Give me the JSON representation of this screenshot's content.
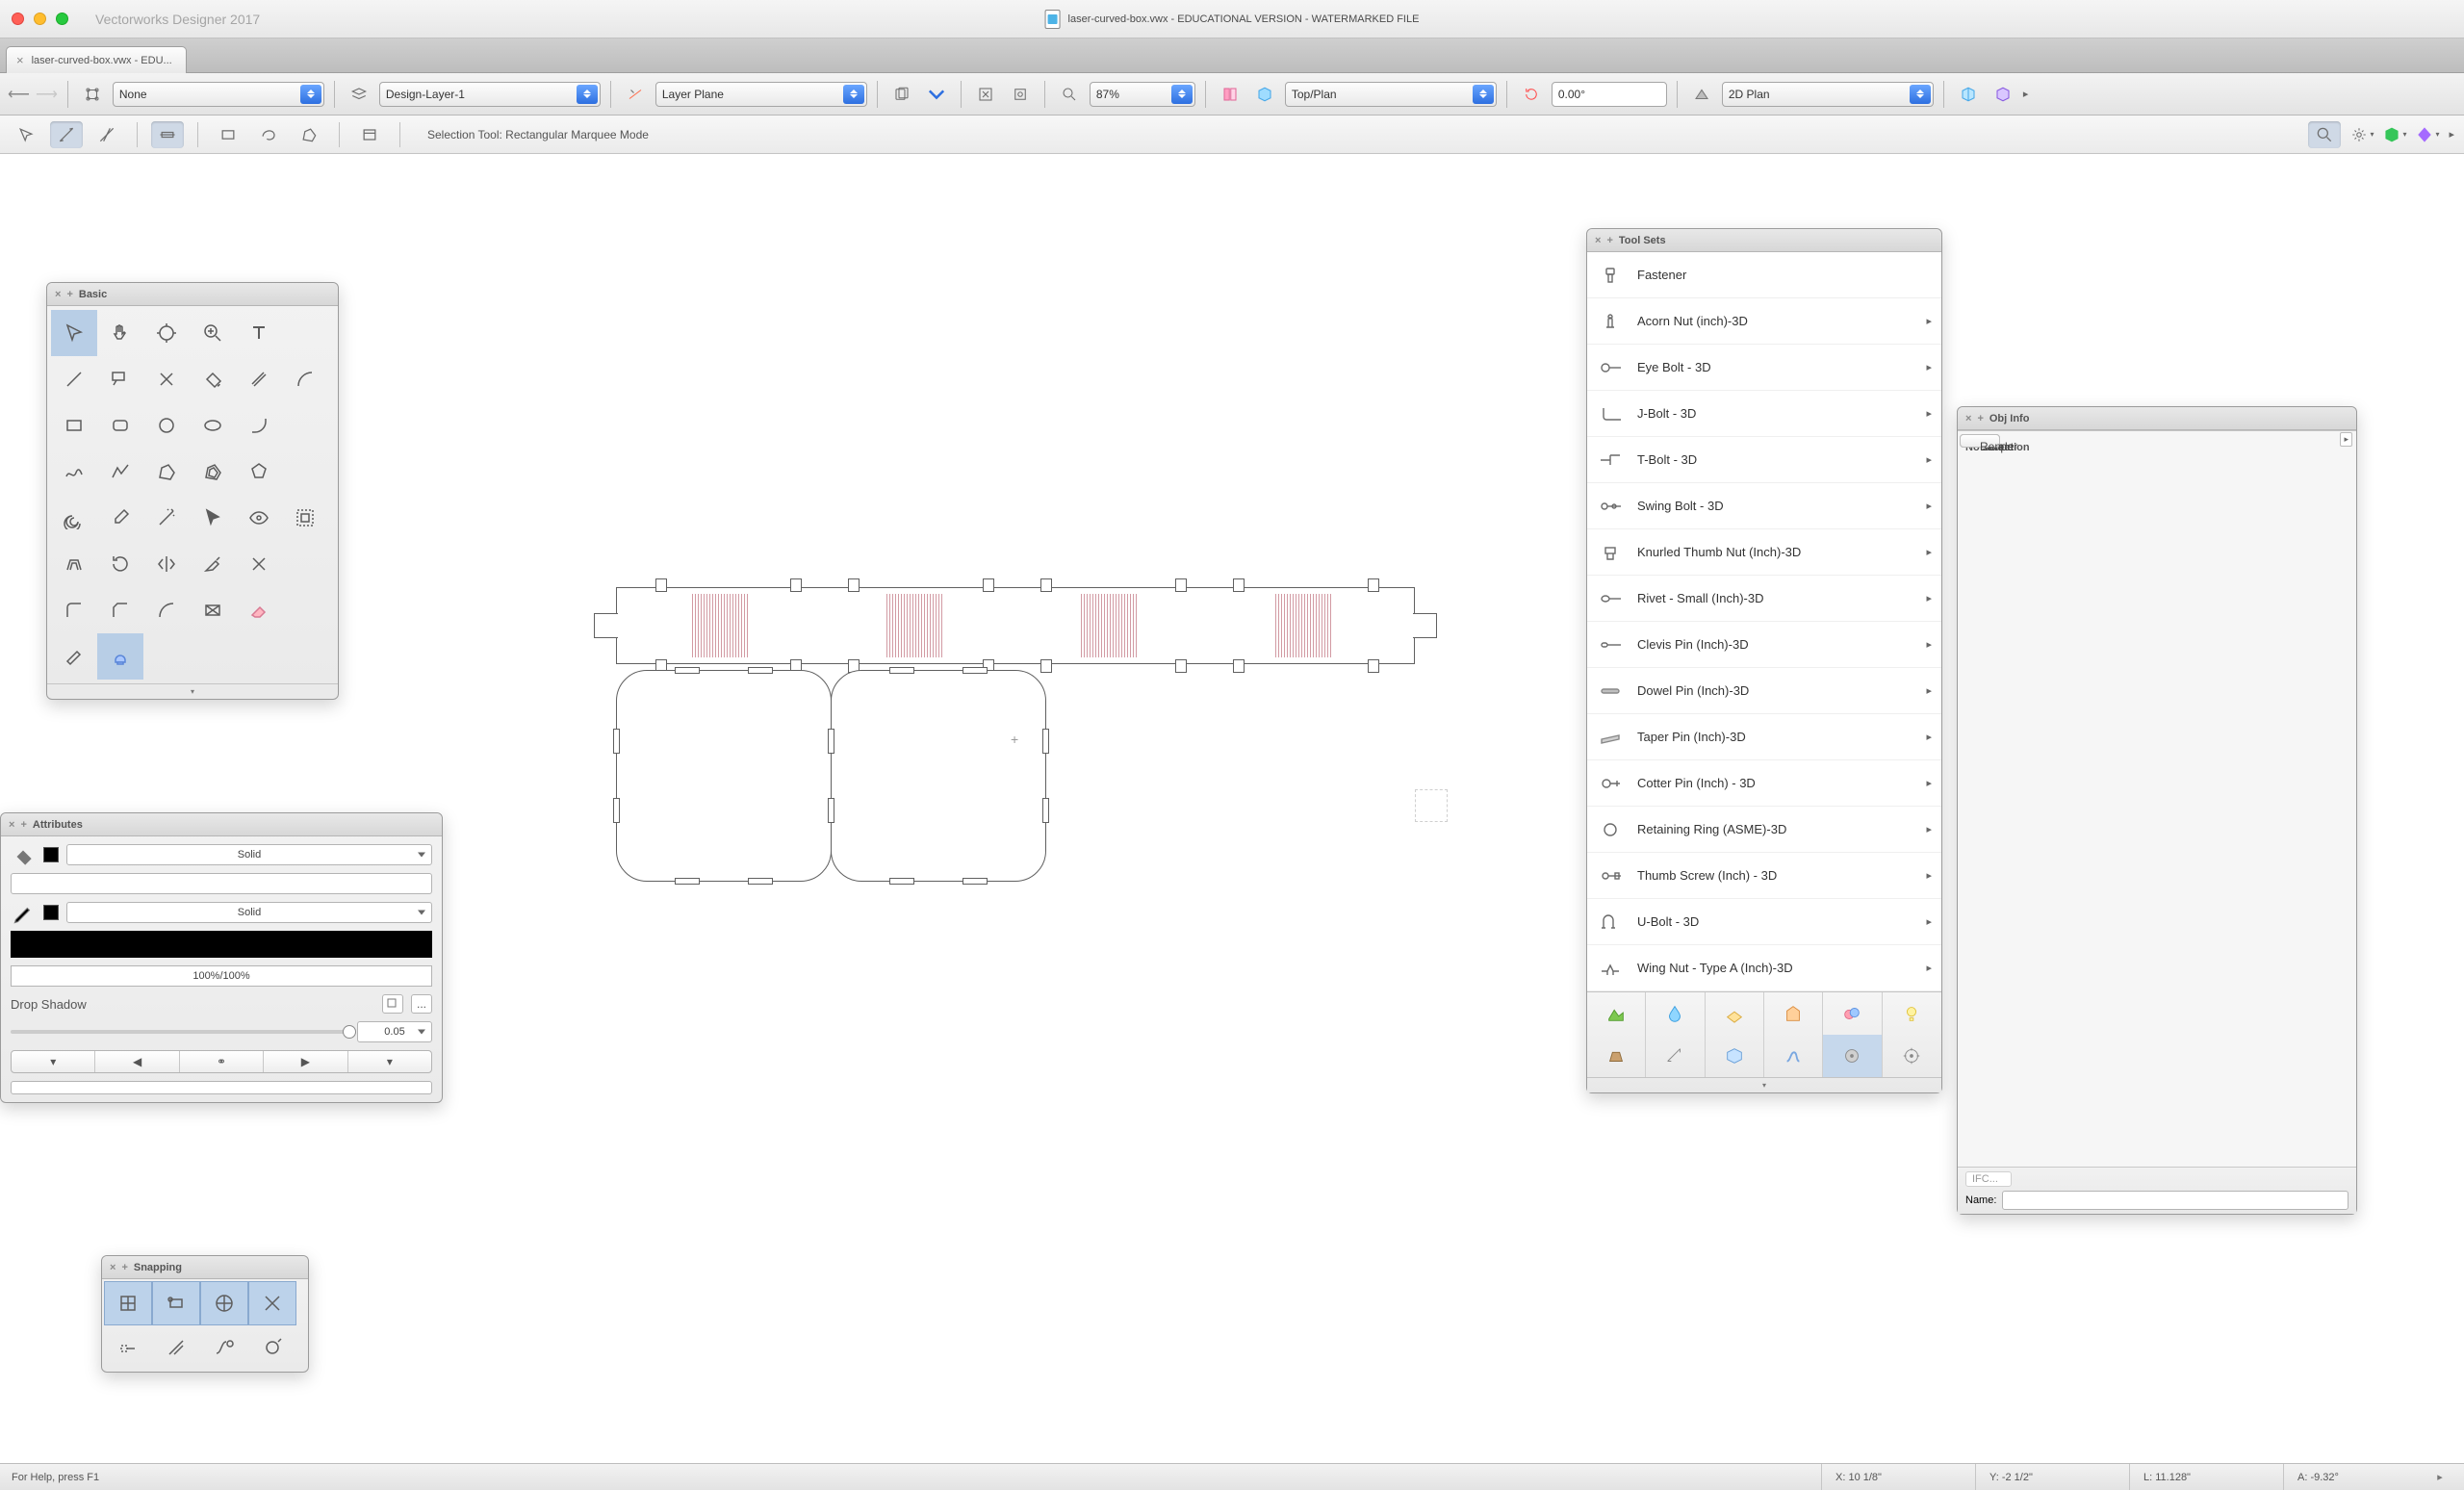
{
  "app": {
    "name": "Vectorworks Designer 2017"
  },
  "window": {
    "title": "laser-curved-box.vwx - EDUCATIONAL VERSION - WATERMARKED FILE"
  },
  "tab": {
    "label": "laser-curved-box.vwx - EDU..."
  },
  "topbar": {
    "class": "None",
    "layer": "Design-Layer-1",
    "plane": "Layer Plane",
    "zoom": "87%",
    "view": "Top/Plan",
    "angle": "0.00°",
    "render": "2D Plan"
  },
  "modebar": {
    "description": "Selection Tool: Rectangular Marquee Mode"
  },
  "palettes": {
    "basic": {
      "title": "Basic"
    },
    "attributes": {
      "title": "Attributes",
      "fillStyle": "Solid",
      "penStyle": "Solid",
      "opacity": "100%/100%",
      "dropShadowLabel": "Drop Shadow",
      "dropShadowMore": "...",
      "shadowValue": "0.05"
    },
    "snapping": {
      "title": "Snapping"
    },
    "toolsets": {
      "title": "Tool Sets",
      "items": [
        {
          "label": "Fastener",
          "expandable": false
        },
        {
          "label": "Acorn Nut (inch)-3D",
          "expandable": true
        },
        {
          "label": "Eye  Bolt - 3D",
          "expandable": true
        },
        {
          "label": "J-Bolt - 3D",
          "expandable": true
        },
        {
          "label": "T-Bolt - 3D",
          "expandable": true
        },
        {
          "label": "Swing Bolt - 3D",
          "expandable": true
        },
        {
          "label": "Knurled Thumb Nut (Inch)-3D",
          "expandable": true
        },
        {
          "label": "Rivet - Small (Inch)-3D",
          "expandable": true
        },
        {
          "label": "Clevis Pin (Inch)-3D",
          "expandable": true
        },
        {
          "label": "Dowel Pin (Inch)-3D",
          "expandable": true
        },
        {
          "label": "Taper Pin (Inch)-3D",
          "expandable": true
        },
        {
          "label": "Cotter Pin (Inch) - 3D",
          "expandable": true
        },
        {
          "label": "Retaining Ring (ASME)-3D",
          "expandable": true
        },
        {
          "label": "Thumb Screw (Inch) - 3D",
          "expandable": true
        },
        {
          "label": "U-Bolt - 3D",
          "expandable": true
        },
        {
          "label": "Wing Nut - Type A (Inch)-3D",
          "expandable": true
        }
      ]
    },
    "objinfo": {
      "title": "Obj Info",
      "tabs": {
        "shape": "Shape",
        "data": "Data",
        "render": "Render"
      },
      "selection": "No Selection",
      "ifc": "IFC...",
      "nameLabel": "Name:",
      "nameValue": ""
    }
  },
  "statusbar": {
    "help": "For Help, press F1",
    "x": "X:  10 1/8\"",
    "y": "Y:   -2 1/2\"",
    "l": "L:  11.128\"",
    "a": "A:  -9.32°"
  }
}
